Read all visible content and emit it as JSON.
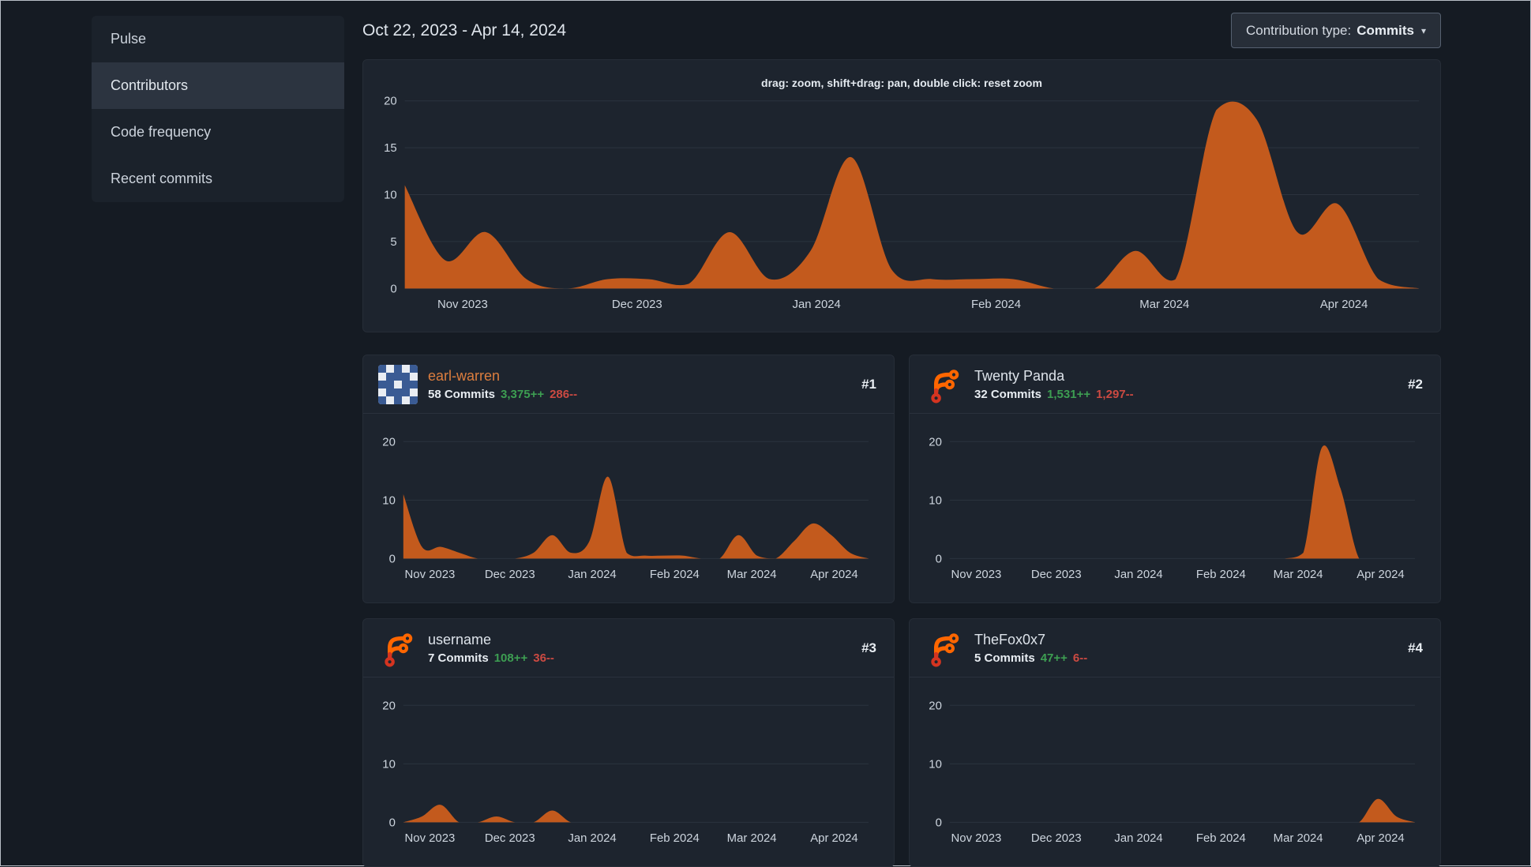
{
  "colors": {
    "page_bg": "#151b23",
    "panel_bg": "#1d242e",
    "area_fill": "#c35a1d",
    "grid_line": "#2b333e",
    "axis_text": "#cdd5de",
    "additions_green": "#3d9e52",
    "deletions_red": "#cc4a42",
    "link_orange": "#dd7e3e",
    "logo_orange": "#ff6600",
    "logo_red": "#d43420"
  },
  "icons": {
    "dropdown_caret": "▾"
  },
  "sidebar": {
    "items": [
      {
        "label": "Pulse",
        "active": false
      },
      {
        "label": "Contributors",
        "active": true
      },
      {
        "label": "Code frequency",
        "active": false
      },
      {
        "label": "Recent commits",
        "active": false
      }
    ]
  },
  "header": {
    "date_range": "Oct 22, 2023 - Apr 14, 2024",
    "contribution_type": {
      "label": "Contribution type:",
      "value": "Commits"
    }
  },
  "main_chart_hint": "drag: zoom, shift+drag: pan, double click: reset zoom",
  "contributors": [
    {
      "rank": "#1",
      "name": "earl-warren",
      "commits": "58 Commits",
      "additions": "3,375++",
      "deletions": "286--",
      "name_color": "#dd7e3e",
      "avatar": {
        "type": "identicon",
        "fg": "#3a5b94",
        "bg": "#e9edf3",
        "pattern": [
          "10101",
          "01110",
          "11011",
          "01110",
          "10101"
        ]
      }
    },
    {
      "rank": "#2",
      "name": "Twenty Panda",
      "commits": "32 Commits",
      "additions": "1,531++",
      "deletions": "1,297--",
      "avatar": {
        "type": "forgejo-logo"
      }
    },
    {
      "rank": "#3",
      "name": "username",
      "commits": "7 Commits",
      "additions": "108++",
      "deletions": "36--",
      "avatar": {
        "type": "forgejo-logo"
      }
    },
    {
      "rank": "#4",
      "name": "TheFox0x7",
      "commits": "5 Commits",
      "additions": "47++",
      "deletions": "6--",
      "avatar": {
        "type": "forgejo-logo"
      }
    }
  ],
  "chart_x": {
    "weeks": [
      "2023-10-22",
      "2023-10-29",
      "2023-11-05",
      "2023-11-12",
      "2023-11-19",
      "2023-11-26",
      "2023-12-03",
      "2023-12-10",
      "2023-12-17",
      "2023-12-24",
      "2023-12-31",
      "2024-01-07",
      "2024-01-14",
      "2024-01-21",
      "2024-01-28",
      "2024-02-04",
      "2024-02-11",
      "2024-02-18",
      "2024-02-25",
      "2024-03-03",
      "2024-03-10",
      "2024-03-17",
      "2024-03-24",
      "2024-03-31",
      "2024-04-07",
      "2024-04-14"
    ],
    "month_tick_labels": [
      "Nov 2023",
      "Dec 2023",
      "Jan 2024",
      "Feb 2024",
      "Mar 2024",
      "Apr 2024"
    ],
    "month_tick_fractions": [
      0.057,
      0.229,
      0.406,
      0.583,
      0.749,
      0.926
    ]
  },
  "chart_data": [
    {
      "type": "area",
      "name": "all-contributors-commits-per-week",
      "xlabel": "",
      "ylabel": "",
      "ylim": [
        0,
        20
      ],
      "y_ticks": [
        0,
        5,
        10,
        15,
        20
      ],
      "grid": true,
      "legend": false,
      "values": [
        11,
        3,
        6,
        1,
        0,
        1,
        1,
        0.5,
        6,
        1,
        4,
        14,
        2,
        1,
        1,
        1,
        0,
        0,
        4,
        1,
        19,
        18,
        6,
        9,
        1,
        0
      ]
    },
    {
      "type": "area",
      "name": "earl-warren-commits-per-week",
      "ylim": [
        0,
        20
      ],
      "y_ticks": [
        0,
        10,
        20
      ],
      "grid": true,
      "legend": false,
      "values": [
        11,
        2,
        2,
        1,
        0,
        0,
        0,
        1,
        4,
        1,
        3,
        14,
        1,
        0.5,
        0.5,
        0.5,
        0,
        0,
        4,
        0.5,
        0,
        3,
        6,
        4,
        1,
        0
      ]
    },
    {
      "type": "area",
      "name": "twenty-panda-commits-per-week",
      "ylim": [
        0,
        20
      ],
      "y_ticks": [
        0,
        10,
        20
      ],
      "grid": true,
      "legend": false,
      "values": [
        0,
        0,
        0,
        0,
        0,
        0,
        0,
        0,
        0,
        0,
        0,
        0,
        0,
        0,
        0,
        0,
        0,
        0,
        0,
        1,
        19,
        12,
        0,
        0,
        0,
        0
      ]
    },
    {
      "type": "area",
      "name": "username-commits-per-week",
      "ylim": [
        0,
        20
      ],
      "y_ticks": [
        0,
        10,
        20
      ],
      "grid": true,
      "legend": false,
      "values": [
        0,
        1,
        3,
        0,
        0,
        1,
        0,
        0,
        2,
        0,
        0,
        0,
        0,
        0,
        0,
        0,
        0,
        0,
        0,
        0,
        0,
        0,
        0,
        0,
        0,
        0
      ]
    },
    {
      "type": "area",
      "name": "thefox0x7-commits-per-week",
      "ylim": [
        0,
        20
      ],
      "y_ticks": [
        0,
        10,
        20
      ],
      "grid": true,
      "legend": false,
      "values": [
        0,
        0,
        0,
        0,
        0,
        0,
        0,
        0,
        0,
        0,
        0,
        0,
        0,
        0,
        0,
        0,
        0,
        0,
        0,
        0,
        0,
        0,
        0,
        4,
        1,
        0
      ]
    }
  ]
}
